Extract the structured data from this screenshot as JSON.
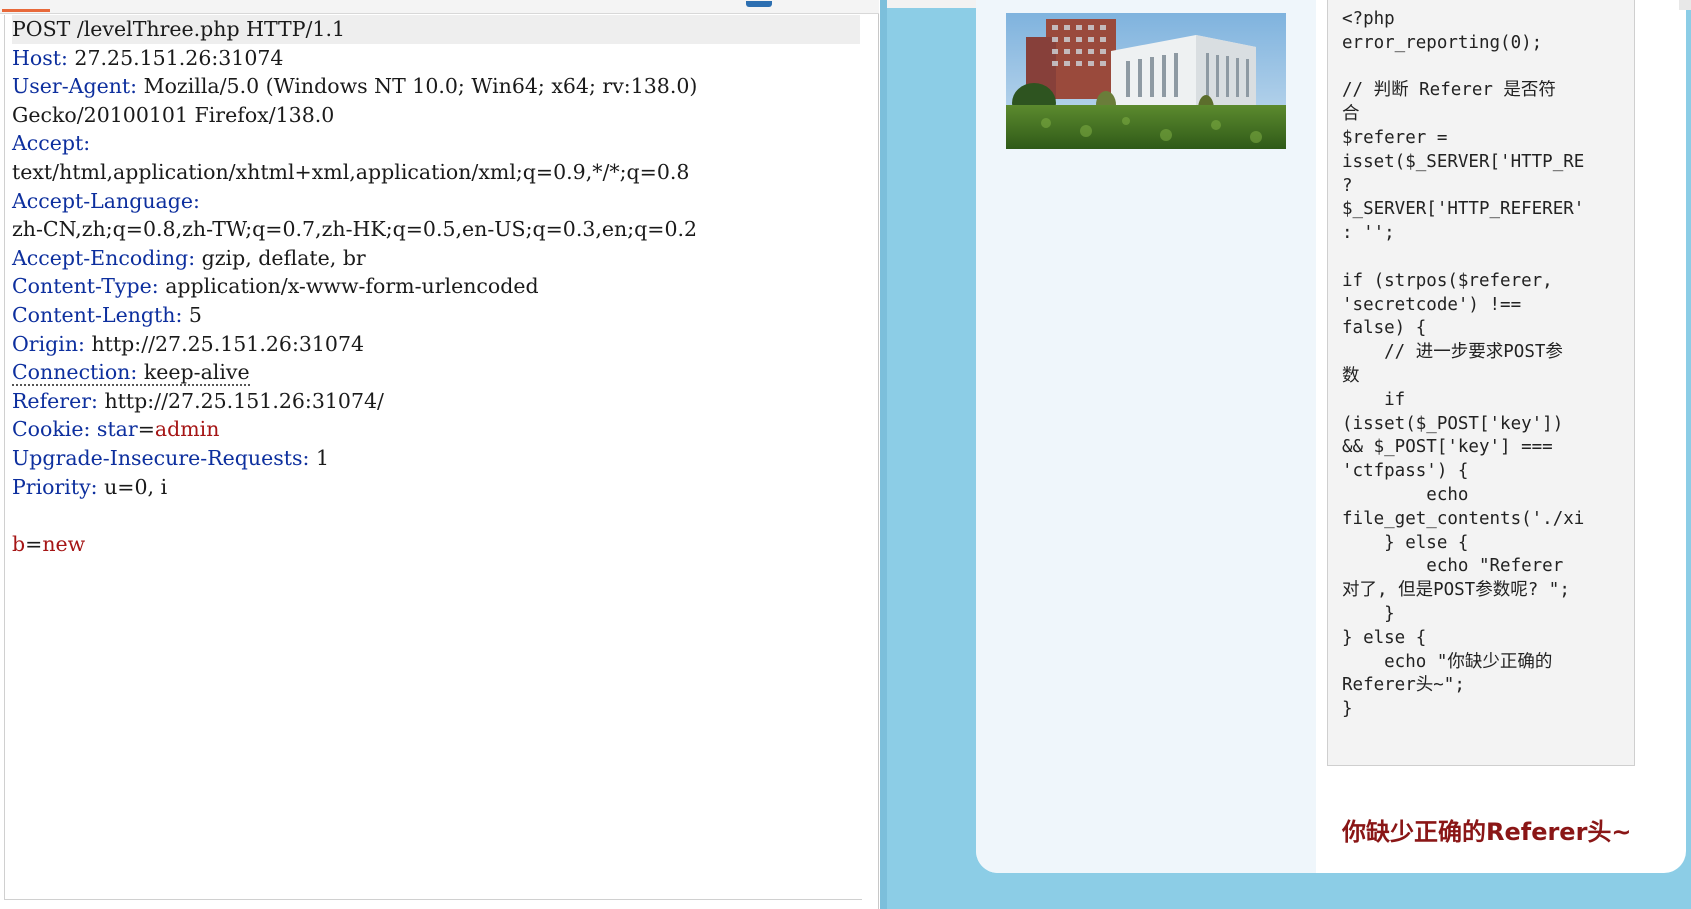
{
  "request": {
    "lines": [
      {
        "name": "",
        "sep": "",
        "value": "POST /levelThree.php HTTP/1.1"
      },
      {
        "name": "Host",
        "sep": ": ",
        "value": "27.25.151.26:31074"
      },
      {
        "name": "User-Agent",
        "sep": ": ",
        "value": "Mozilla/5.0 (Windows NT 10.0; Win64; x64; rv:138.0)"
      },
      {
        "name": "",
        "sep": "",
        "value": "Gecko/20100101 Firefox/138.0"
      },
      {
        "name": "Accept",
        "sep": ":",
        "value": ""
      },
      {
        "name": "",
        "sep": "",
        "value": "text/html,application/xhtml+xml,application/xml;q=0.9,*/*;q=0.8"
      },
      {
        "name": "Accept-Language",
        "sep": ":",
        "value": ""
      },
      {
        "name": "",
        "sep": "",
        "value": "zh-CN,zh;q=0.8,zh-TW;q=0.7,zh-HK;q=0.5,en-US;q=0.3,en;q=0.2"
      },
      {
        "name": "Accept-Encoding",
        "sep": ": ",
        "value": "gzip, deflate, br"
      },
      {
        "name": "Content-Type",
        "sep": ": ",
        "value": "application/x-www-form-urlencoded"
      },
      {
        "name": "Content-Length",
        "sep": ": ",
        "value": "5"
      },
      {
        "name": "Origin",
        "sep": ": ",
        "value": "http://27.25.151.26:31074"
      },
      {
        "name": "Connection",
        "sep": ": ",
        "value": "keep-alive",
        "underline": true
      },
      {
        "name": "Referer",
        "sep": ": ",
        "value": "http://27.25.151.26:31074/"
      },
      {
        "name": "Cookie",
        "sep": ": ",
        "value": "star",
        "eq": "=",
        "value2": "admin"
      },
      {
        "name": "Upgrade-Insecure-Requests",
        "sep": ": ",
        "value": "1"
      },
      {
        "name": "Priority",
        "sep": ": ",
        "value": "u=0, i"
      },
      {
        "name": "",
        "sep": "",
        "value": ""
      },
      {
        "name": "",
        "sep": "",
        "value": "",
        "body_key": "b",
        "eq": "=",
        "value2": "new"
      }
    ]
  },
  "page": {
    "code_lines": [
      "<?php",
      "error_reporting(0);",
      "",
      "// 判断 Referer 是否符",
      "合",
      "$referer =",
      "isset($_SERVER['HTTP_RE",
      "?",
      "$_SERVER['HTTP_REFERER'",
      ": '';",
      "",
      "if (strpos($referer,",
      "'secretcode') !==",
      "false) {",
      "    // 进一步要求POST参",
      "数",
      "    if",
      "(isset($_POST['key'])",
      "&& $_POST['key'] ===",
      "'ctfpass') {",
      "        echo",
      "file_get_contents('./xi",
      "    } else {",
      "        echo \"Referer",
      "对了, 但是POST参数呢? \";",
      "    }",
      "} else {",
      "    echo \"你缺少正确的",
      "Referer头~\";",
      "}"
    ],
    "message": "你缺少正确的Referer头~"
  },
  "colors": {
    "header_name": "#0d2f9e",
    "cookie_value": "#a51515",
    "message": "#8a1616",
    "background": "#8ccde6",
    "tab_accent": "#e8693a"
  }
}
